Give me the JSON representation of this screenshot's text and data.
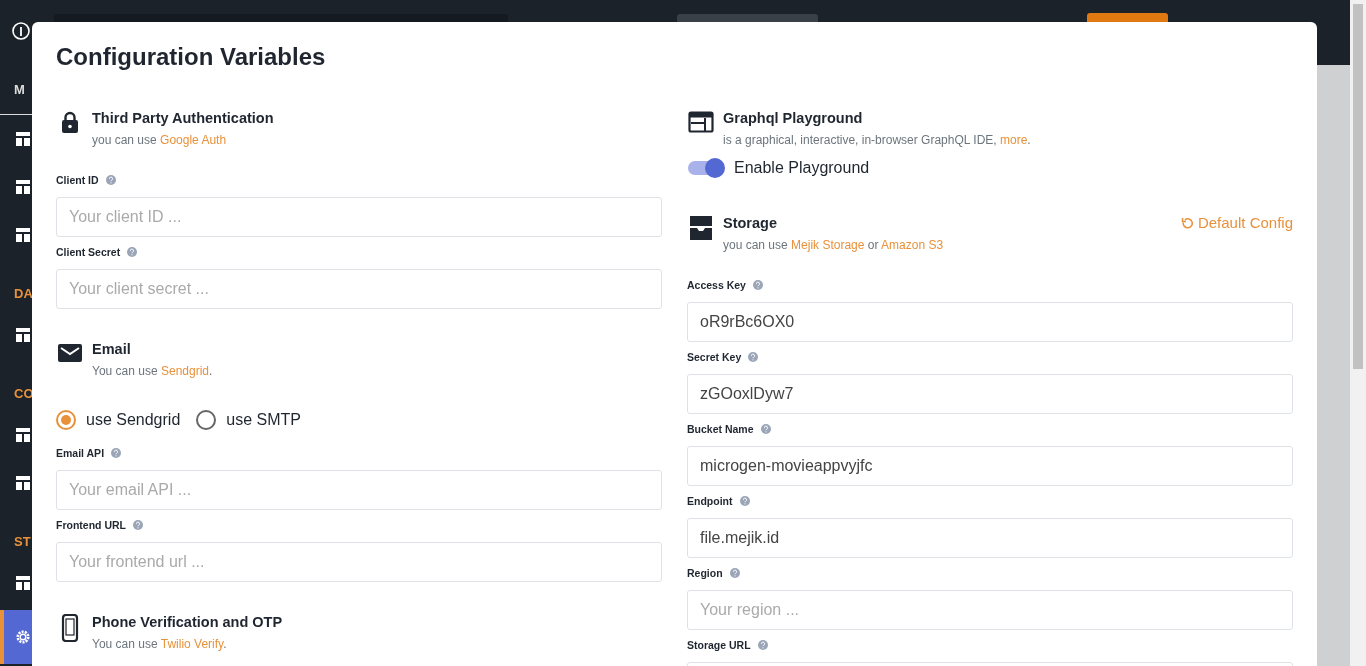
{
  "app": {
    "sidebar": {
      "items": [
        {
          "kind": "tab",
          "text": "M"
        },
        {
          "kind": "icon",
          "selected": false
        },
        {
          "kind": "icon",
          "selected": false
        },
        {
          "kind": "icon",
          "selected": false
        },
        {
          "kind": "heading",
          "text": "DA"
        },
        {
          "kind": "icon",
          "selected": false
        },
        {
          "kind": "heading",
          "text": "CO"
        },
        {
          "kind": "icon",
          "selected": false
        },
        {
          "kind": "icon",
          "selected": false
        },
        {
          "kind": "heading",
          "text": "ST"
        },
        {
          "kind": "icon",
          "selected": false
        },
        {
          "kind": "icon",
          "selected": true
        }
      ]
    }
  },
  "modal": {
    "title": "Configuration Variables",
    "columns": [
      [
        {
          "kind": "auth",
          "title": "Third Party Authentication",
          "subtitle": [
            {
              "text": "you can use "
            },
            {
              "link": "Google Auth"
            }
          ]
        },
        {
          "kind": "field",
          "label": "Client ID",
          "placeholder": "Your client ID ..."
        },
        {
          "kind": "field",
          "label": "Client Secret",
          "placeholder": "Your client secret ..."
        },
        {
          "kind": "email",
          "title": "Email",
          "subtitle": [
            {
              "text": "You can use "
            },
            {
              "link": "Sendgrid"
            },
            {
              "text": "."
            }
          ]
        },
        {
          "kind": "radio_group",
          "options": [
            {
              "label": "use Sendgrid",
              "selected": true
            },
            {
              "label": "use SMTP",
              "selected": false
            }
          ]
        },
        {
          "kind": "field",
          "label": "Email API",
          "placeholder": "Your email API ..."
        },
        {
          "kind": "field",
          "label": "Frontend URL",
          "placeholder": "Your frontend url ..."
        },
        {
          "kind": "phone",
          "title": "Phone Verification and OTP",
          "subtitle": [
            {
              "text": "You can use "
            },
            {
              "link": "Twilio Verify"
            },
            {
              "text": "."
            }
          ]
        }
      ],
      [
        {
          "kind": "playground",
          "title": "Graphql Playground",
          "subtitle": [
            {
              "text": "is a graphical, interactive, in-browser GraphQL IDE, "
            },
            {
              "link": "more"
            },
            {
              "text": "."
            }
          ]
        },
        {
          "kind": "toggle",
          "label": "Enable Playground",
          "on": true
        },
        {
          "kind": "storage",
          "title": "Storage",
          "subtitle": [
            {
              "text": "you can use "
            },
            {
              "link": "Mejik Storage"
            },
            {
              "text": " or "
            },
            {
              "link": "Amazon S3"
            }
          ],
          "action": "Default Config"
        },
        {
          "kind": "field",
          "label": "Access Key",
          "value": "oR9rBc6OX0"
        },
        {
          "kind": "field",
          "label": "Secret Key",
          "value": "zGOoxlDyw7"
        },
        {
          "kind": "field",
          "label": "Bucket Name",
          "value": "microgen-movieappvyjfc"
        },
        {
          "kind": "field",
          "label": "Endpoint",
          "value": "file.mejik.id"
        },
        {
          "kind": "field",
          "label": "Region",
          "placeholder": "Your region ..."
        },
        {
          "kind": "field",
          "label": "Storage URL"
        }
      ]
    ]
  }
}
